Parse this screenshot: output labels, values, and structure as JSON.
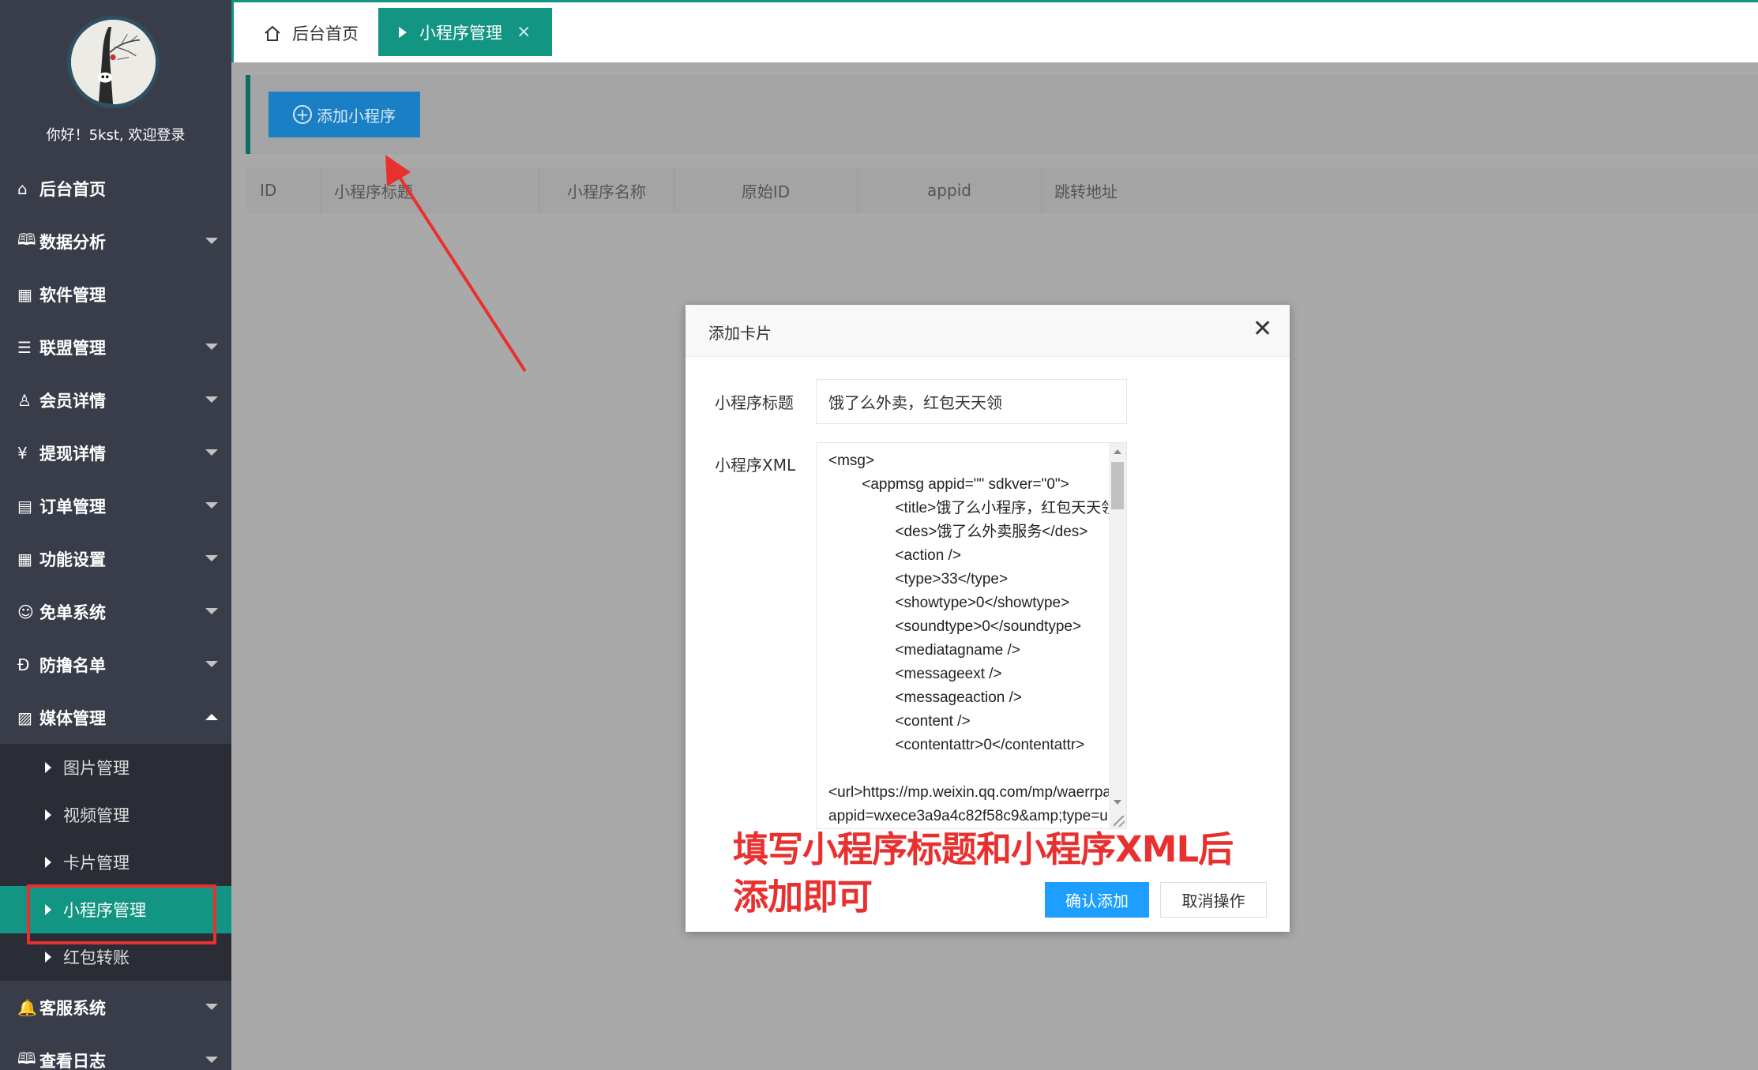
{
  "user": {
    "welcome": "你好！5kst, 欢迎登录"
  },
  "sidebar": {
    "items": [
      {
        "label": "后台首页",
        "icon": "⌂",
        "has_caret": false
      },
      {
        "label": "数据分析",
        "icon": "🕮",
        "has_caret": true
      },
      {
        "label": "软件管理",
        "icon": "▦",
        "has_caret": false
      },
      {
        "label": "联盟管理",
        "icon": "☰",
        "has_caret": true
      },
      {
        "label": "会员详情",
        "icon": "♙",
        "has_caret": true
      },
      {
        "label": "提现详情",
        "icon": "¥",
        "has_caret": true
      },
      {
        "label": "订单管理",
        "icon": "▤",
        "has_caret": true
      },
      {
        "label": "功能设置",
        "icon": "▦",
        "has_caret": true
      },
      {
        "label": "免单系统",
        "icon": "☺",
        "has_caret": true
      },
      {
        "label": "防撸名单",
        "icon": "Ð",
        "has_caret": true
      },
      {
        "label": "媒体管理",
        "icon": "▨",
        "has_caret": true,
        "open": true
      }
    ],
    "submenu": [
      {
        "label": "图片管理"
      },
      {
        "label": "视频管理"
      },
      {
        "label": "卡片管理"
      },
      {
        "label": "小程序管理",
        "active": true
      },
      {
        "label": "红包转账"
      }
    ],
    "after": [
      {
        "label": "客服系统",
        "icon": "🔔",
        "has_caret": true
      },
      {
        "label": "查看日志",
        "icon": "🕮",
        "has_caret": true
      }
    ]
  },
  "tabs": {
    "home": "后台首页",
    "active": "小程序管理",
    "close": "×"
  },
  "toolbar": {
    "add_label": "添加小程序",
    "add_icon": "+"
  },
  "table": {
    "columns": [
      "ID",
      "小程序标题",
      "小程序名称",
      "原始ID",
      "appid",
      "跳转地址"
    ]
  },
  "modal": {
    "title": "添加卡片",
    "close": "✕",
    "title_label": "小程序标题",
    "title_value": "饿了么外卖，红包天天领",
    "xml_label": "小程序XML",
    "xml_value": "<msg>\n        <appmsg appid=\"\" sdkver=\"0\">\n                <title>饿了么小程序，红包天天领</title>\n                <des>饿了么外卖服务</des>\n                <action />\n                <type>33</type>\n                <showtype>0</showtype>\n                <soundtype>0</soundtype>\n                <mediatagname />\n                <messageext />\n                <messageaction />\n                <content />\n                <contentattr>0</contentattr>\n\n<url>https://mp.weixin.qq.com/mp/waerrpage?\nappid=wxece3a9a4c82f58c9&amp;type=upgrade",
    "confirm": "确认添加",
    "cancel": "取消操作"
  },
  "annotation": {
    "line1": "填写小程序标题和小程序XML后",
    "line2": "添加即可",
    "color": "#e8312f"
  },
  "colors": {
    "sidebar": "#393d49",
    "accent": "#129583",
    "primary": "#1e9fff",
    "annotation": "#e8312f"
  }
}
